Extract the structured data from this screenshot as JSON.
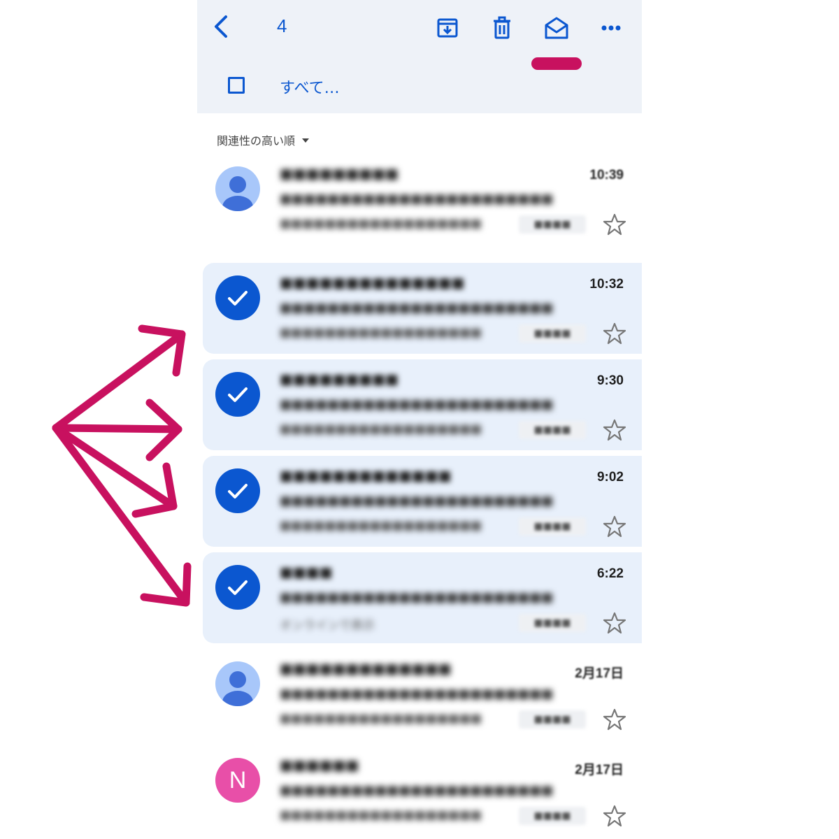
{
  "toolbar": {
    "selected_count": "4",
    "back_icon": "arrow-back-icon",
    "archive_icon": "archive-icon",
    "delete_icon": "trash-icon",
    "mark_read_icon": "mail-open-icon",
    "more_icon": "more-horiz-icon",
    "select_all_label": "すべて…"
  },
  "list": {
    "sort_label": "関連性の高い順"
  },
  "emails": [
    {
      "time": "10:39",
      "selected": false,
      "avatar": "person-icon",
      "sender": "■■■■■■■■■",
      "subject": "■■■■■■■■■■■■■■■■■■■■■■■",
      "snippet": "■■■■■■■■■■■■■■■■■■",
      "chip": "■■■■"
    },
    {
      "time": "10:32",
      "selected": true,
      "avatar": "check-icon",
      "sender": "■■■■■■■■■■■■■■",
      "subject": "■■■■■■■■■■■■■■■■■■■■■■■",
      "snippet": "■■■■■■■■■■■■■■■■■■",
      "chip": "■■■■"
    },
    {
      "time": "9:30",
      "selected": true,
      "avatar": "check-icon",
      "sender": "■■■■■■■■■",
      "subject": "■■■■■■■■■■■■■■■■■■■■■■■",
      "snippet": "■■■■■■■■■■■■■■■■■■",
      "chip": "■■■■"
    },
    {
      "time": "9:02",
      "selected": true,
      "avatar": "check-icon",
      "sender": "■■■■■■■■■■■■■",
      "subject": "■■■■■■■■■■■■■■■■■■■■■■■",
      "snippet": "■■■■■■■■■■■■■■■■■■",
      "chip": "■■■■"
    },
    {
      "time": "6:22",
      "selected": true,
      "avatar": "check-icon",
      "sender": "■■■■",
      "subject": "■■■■■■■■■■■■■■■■■■■■■■■",
      "snippet": "オンラインで表示",
      "chip": "■■■■"
    },
    {
      "time": "2月17日",
      "selected": false,
      "avatar": "person-icon",
      "sender": "■■■■■■■■■■■■■",
      "subject": "■■■■■■■■■■■■■■■■■■■■■■■",
      "snippet": "■■■■■■■■■■■■■■■■■■",
      "chip": "■■■■"
    },
    {
      "time": "2月17日",
      "selected": false,
      "avatar": "N",
      "sender": "■■■■■■",
      "subject": "■■■■■■■■■■■■■■■■■■■■■■■",
      "snippet": "■■■■■■■■■■■■■■■■■■",
      "chip": "■■■■"
    }
  ],
  "colors": {
    "accent": "#0b57d0",
    "annotation": "#c8115f",
    "selected_row_bg": "#e8f0fb",
    "toolbar_bg": "#eef2f8",
    "letter_avatar": "#e84fa8"
  }
}
